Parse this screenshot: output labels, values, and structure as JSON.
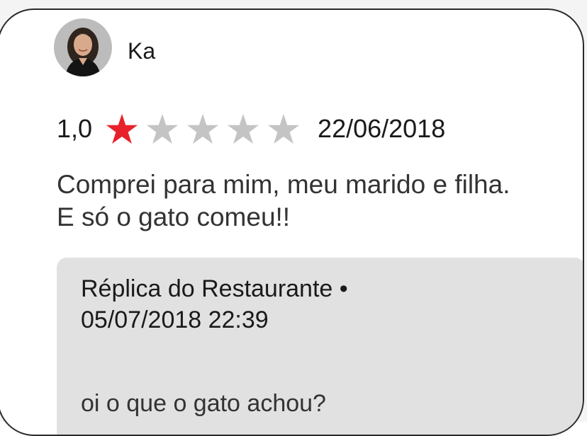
{
  "review": {
    "author": "Ka",
    "rating_label": "1,0",
    "rating": 1,
    "max_rating": 5,
    "date": "22/06/2018",
    "text_line1": "Comprei para mim, meu marido e filha.",
    "text_line2": "E só o gato comeu!!"
  },
  "reply": {
    "title": "Réplica do Restaurante •",
    "datetime": "05/07/2018 22:39",
    "text": "oi o que o gato achou?"
  },
  "colors": {
    "star_filled": "#e8222a",
    "star_empty": "#c4c4c4",
    "reply_background": "#e1e1e1"
  },
  "icons": {
    "avatar": "profile-photo",
    "star": "star-icon"
  }
}
